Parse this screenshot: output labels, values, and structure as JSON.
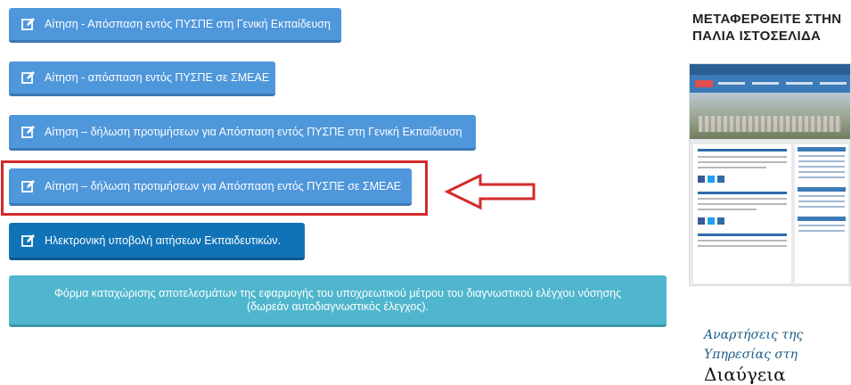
{
  "buttons": [
    {
      "label": "Αίτηση - Απόσπαση εντός ΠΥΣΠΕ στη Γενική Εκπαίδευση"
    },
    {
      "label": "Αίτηση - απόσπαση εντός ΠΥΣΠΕ σε ΣΜΕΑΕ"
    },
    {
      "label": "Αίτηση – δήλωση προτιμήσεων για Απόσπαση εντός ΠΥΣΠΕ στη Γενική Εκπαίδευση"
    },
    {
      "label": "Αίτηση – δήλωση προτιμήσεων για Απόσπαση εντός ΠΥΣΠΕ σε ΣΜΕΑΕ"
    },
    {
      "label": "Ηλεκτρονική υποβολή αιτήσεων Εκπαιδευτικών."
    }
  ],
  "form_button": {
    "label": "Φόρμα καταχώρισης αποτελεσμάτων της εφαρμογής του υποχρεωτικού μέτρου του διαγνωστικού ελέγχου νόσησης (δωρεάν αυτοδιαγνωστικός έλεγχος)."
  },
  "sidebar": {
    "old_site_title": "ΜΕΤΑΦΕΡΘΕΙΤΕ ΣΤΗΝ ΠΑΛΙΑ ΙΣΤΟΣΕΛΙΔΑ",
    "posts_line1": "Αναρτήσεις της",
    "posts_line2": "Υπηρεσίας στη",
    "posts_line3": "Διαύγεια"
  },
  "colors": {
    "button_light": "#4f97db",
    "button_dark": "#1173b7",
    "button_teal": "#4fb6cd",
    "highlight_red": "#d42a2a"
  },
  "icons": {
    "button_icon": "edit-icon",
    "pointer": "arrow-left-icon"
  }
}
